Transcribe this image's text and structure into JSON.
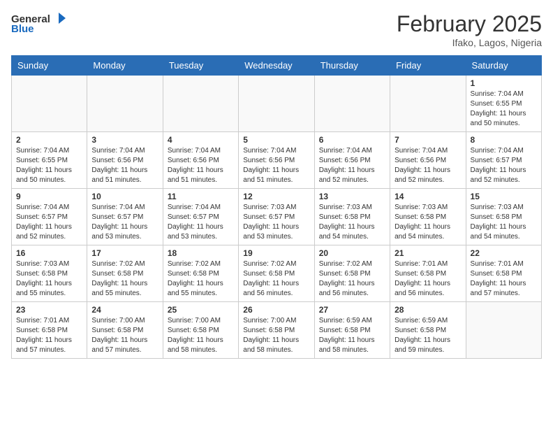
{
  "header": {
    "logo_general": "General",
    "logo_blue": "Blue",
    "month": "February 2025",
    "location": "Ifako, Lagos, Nigeria"
  },
  "days_of_week": [
    "Sunday",
    "Monday",
    "Tuesday",
    "Wednesday",
    "Thursday",
    "Friday",
    "Saturday"
  ],
  "weeks": [
    [
      {
        "day": "",
        "info": ""
      },
      {
        "day": "",
        "info": ""
      },
      {
        "day": "",
        "info": ""
      },
      {
        "day": "",
        "info": ""
      },
      {
        "day": "",
        "info": ""
      },
      {
        "day": "",
        "info": ""
      },
      {
        "day": "1",
        "info": "Sunrise: 7:04 AM\nSunset: 6:55 PM\nDaylight: 11 hours and 50 minutes."
      }
    ],
    [
      {
        "day": "2",
        "info": "Sunrise: 7:04 AM\nSunset: 6:55 PM\nDaylight: 11 hours and 50 minutes."
      },
      {
        "day": "3",
        "info": "Sunrise: 7:04 AM\nSunset: 6:56 PM\nDaylight: 11 hours and 51 minutes."
      },
      {
        "day": "4",
        "info": "Sunrise: 7:04 AM\nSunset: 6:56 PM\nDaylight: 11 hours and 51 minutes."
      },
      {
        "day": "5",
        "info": "Sunrise: 7:04 AM\nSunset: 6:56 PM\nDaylight: 11 hours and 51 minutes."
      },
      {
        "day": "6",
        "info": "Sunrise: 7:04 AM\nSunset: 6:56 PM\nDaylight: 11 hours and 52 minutes."
      },
      {
        "day": "7",
        "info": "Sunrise: 7:04 AM\nSunset: 6:56 PM\nDaylight: 11 hours and 52 minutes."
      },
      {
        "day": "8",
        "info": "Sunrise: 7:04 AM\nSunset: 6:57 PM\nDaylight: 11 hours and 52 minutes."
      }
    ],
    [
      {
        "day": "9",
        "info": "Sunrise: 7:04 AM\nSunset: 6:57 PM\nDaylight: 11 hours and 52 minutes."
      },
      {
        "day": "10",
        "info": "Sunrise: 7:04 AM\nSunset: 6:57 PM\nDaylight: 11 hours and 53 minutes."
      },
      {
        "day": "11",
        "info": "Sunrise: 7:04 AM\nSunset: 6:57 PM\nDaylight: 11 hours and 53 minutes."
      },
      {
        "day": "12",
        "info": "Sunrise: 7:03 AM\nSunset: 6:57 PM\nDaylight: 11 hours and 53 minutes."
      },
      {
        "day": "13",
        "info": "Sunrise: 7:03 AM\nSunset: 6:58 PM\nDaylight: 11 hours and 54 minutes."
      },
      {
        "day": "14",
        "info": "Sunrise: 7:03 AM\nSunset: 6:58 PM\nDaylight: 11 hours and 54 minutes."
      },
      {
        "day": "15",
        "info": "Sunrise: 7:03 AM\nSunset: 6:58 PM\nDaylight: 11 hours and 54 minutes."
      }
    ],
    [
      {
        "day": "16",
        "info": "Sunrise: 7:03 AM\nSunset: 6:58 PM\nDaylight: 11 hours and 55 minutes."
      },
      {
        "day": "17",
        "info": "Sunrise: 7:02 AM\nSunset: 6:58 PM\nDaylight: 11 hours and 55 minutes."
      },
      {
        "day": "18",
        "info": "Sunrise: 7:02 AM\nSunset: 6:58 PM\nDaylight: 11 hours and 55 minutes."
      },
      {
        "day": "19",
        "info": "Sunrise: 7:02 AM\nSunset: 6:58 PM\nDaylight: 11 hours and 56 minutes."
      },
      {
        "day": "20",
        "info": "Sunrise: 7:02 AM\nSunset: 6:58 PM\nDaylight: 11 hours and 56 minutes."
      },
      {
        "day": "21",
        "info": "Sunrise: 7:01 AM\nSunset: 6:58 PM\nDaylight: 11 hours and 56 minutes."
      },
      {
        "day": "22",
        "info": "Sunrise: 7:01 AM\nSunset: 6:58 PM\nDaylight: 11 hours and 57 minutes."
      }
    ],
    [
      {
        "day": "23",
        "info": "Sunrise: 7:01 AM\nSunset: 6:58 PM\nDaylight: 11 hours and 57 minutes."
      },
      {
        "day": "24",
        "info": "Sunrise: 7:00 AM\nSunset: 6:58 PM\nDaylight: 11 hours and 57 minutes."
      },
      {
        "day": "25",
        "info": "Sunrise: 7:00 AM\nSunset: 6:58 PM\nDaylight: 11 hours and 58 minutes."
      },
      {
        "day": "26",
        "info": "Sunrise: 7:00 AM\nSunset: 6:58 PM\nDaylight: 11 hours and 58 minutes."
      },
      {
        "day": "27",
        "info": "Sunrise: 6:59 AM\nSunset: 6:58 PM\nDaylight: 11 hours and 58 minutes."
      },
      {
        "day": "28",
        "info": "Sunrise: 6:59 AM\nSunset: 6:58 PM\nDaylight: 11 hours and 59 minutes."
      },
      {
        "day": "",
        "info": ""
      }
    ]
  ]
}
